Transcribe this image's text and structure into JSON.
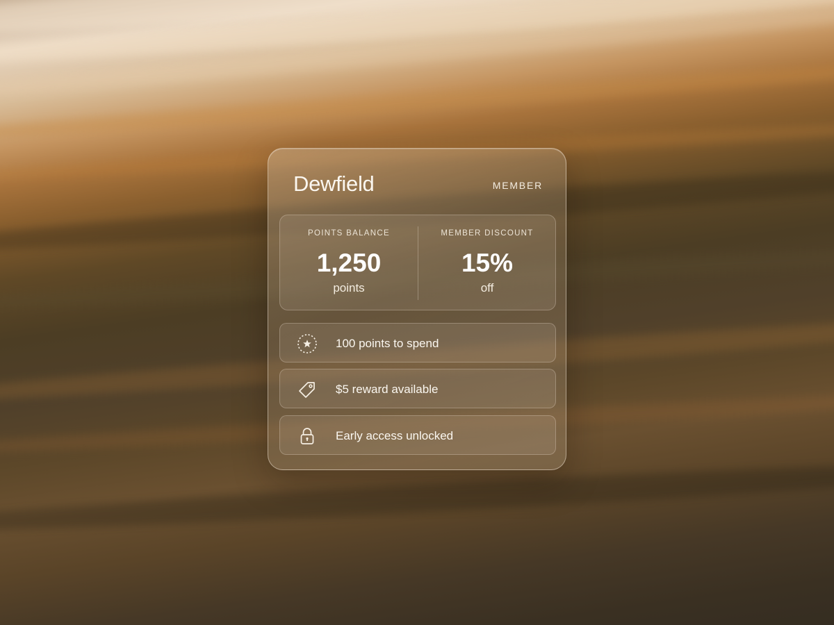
{
  "card": {
    "brand": "Dewfield",
    "tier": "MEMBER"
  },
  "stats": {
    "points": {
      "label": "POINTS BALANCE",
      "value": "1,250",
      "unit": "points"
    },
    "discount": {
      "label": "MEMBER DISCOUNT",
      "value": "15%",
      "unit": "off"
    }
  },
  "perks": [
    {
      "icon": "star-badge-icon",
      "label": "100 points to spend"
    },
    {
      "icon": "tag-icon",
      "label": "$5 reward available"
    },
    {
      "icon": "lock-icon",
      "label": "Early access unlocked"
    }
  ],
  "colors": {
    "text": "#fbf7f0",
    "card_border": "rgba(255,245,230,0.45)",
    "background_warm": "#c59561",
    "background_dark": "#352d21"
  }
}
